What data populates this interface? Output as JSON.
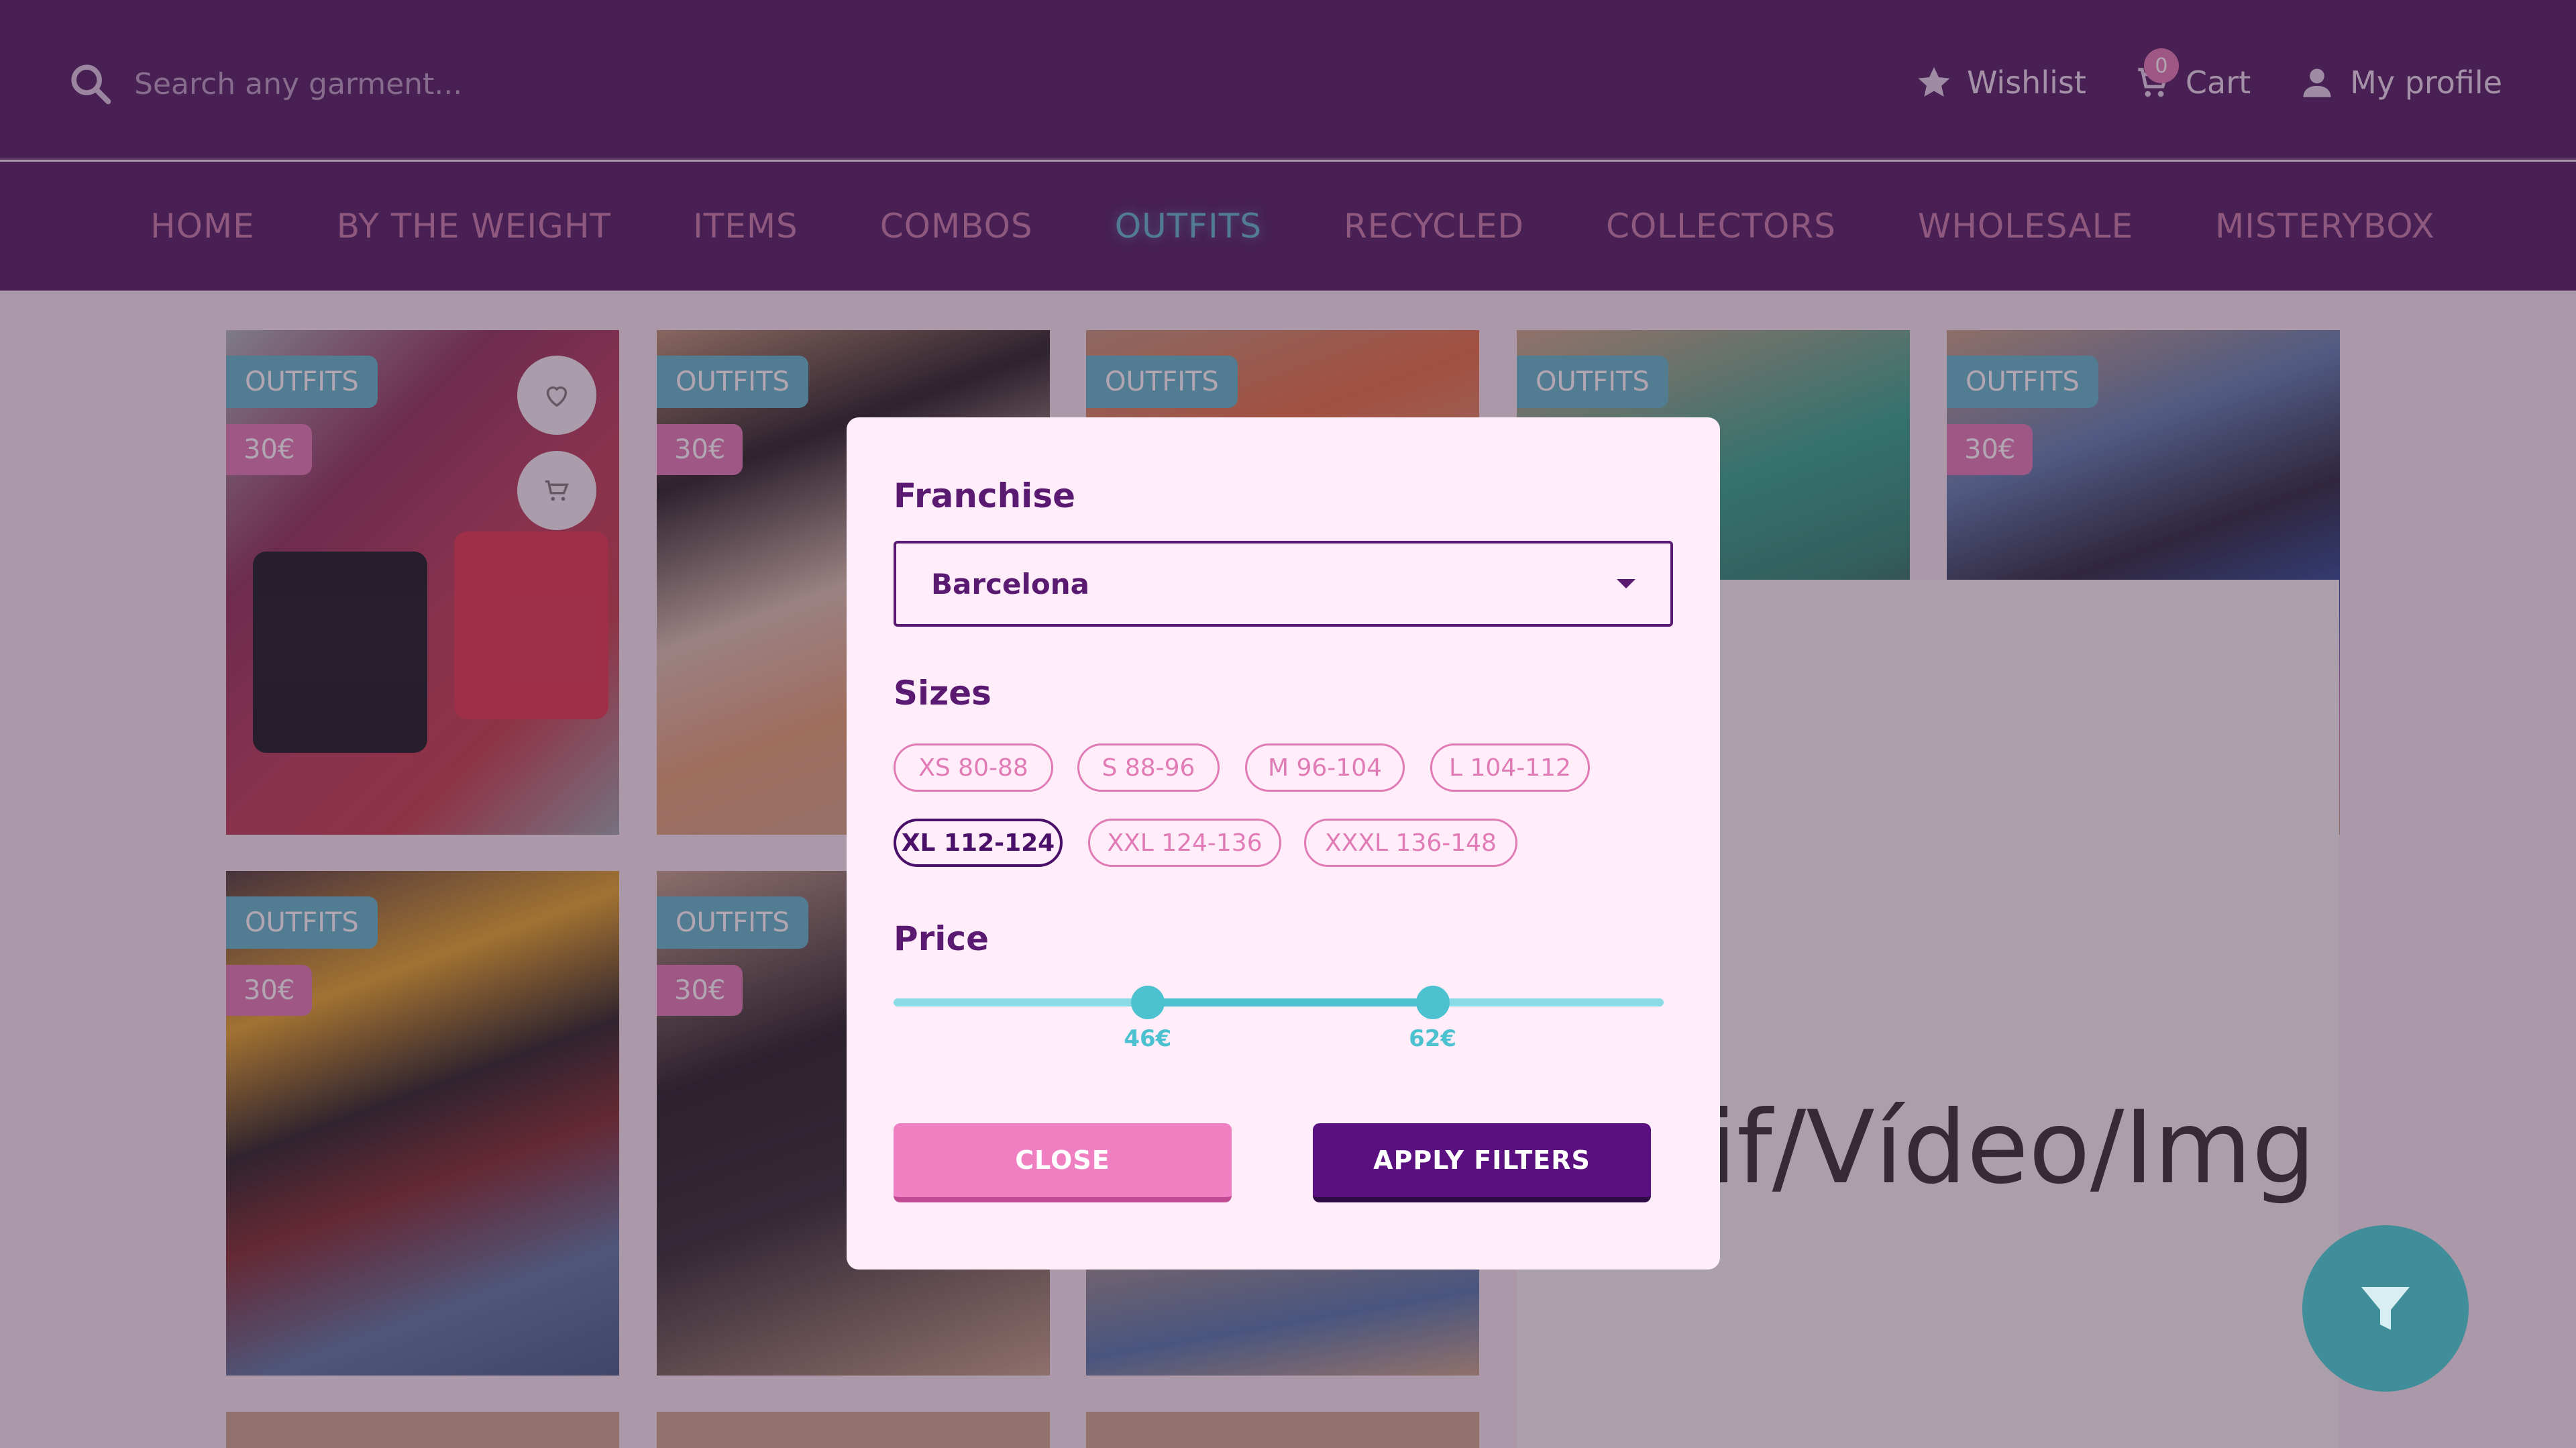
{
  "header": {
    "search_placeholder": "Search any garment...",
    "wishlist_label": "Wishlist",
    "cart_label": "Cart",
    "cart_count": "0",
    "profile_label": "My profile"
  },
  "nav": {
    "items": [
      "HOME",
      "BY THE WEIGHT",
      "ITEMS",
      "COMBOS",
      "OUTFITS",
      "RECYCLED",
      "COLLECTORS",
      "WHOLESALE",
      "MISTERYBOX"
    ],
    "active": "OUTFITS"
  },
  "products": [
    {
      "category": "OUTFITS",
      "price": "30€"
    },
    {
      "category": "OUTFITS",
      "price": "30€"
    },
    {
      "category": "OUTFITS",
      "price": "30€"
    },
    {
      "category": "OUTFITS",
      "price": "30€"
    },
    {
      "category": "OUTFITS",
      "price": "30€"
    },
    {
      "category": "OUTFITS",
      "price": "30€"
    },
    {
      "category": "OUTFITS",
      "price": "30€"
    },
    {
      "category": "OUTFITS",
      "price": "30€"
    }
  ],
  "media_placeholder": "Gif/Vídeo/Img",
  "filter_modal": {
    "franchise_title": "Franchise",
    "franchise_value": "Barcelona",
    "sizes_title": "Sizes",
    "sizes": [
      {
        "label": "XS 80-88",
        "selected": false
      },
      {
        "label": "S 88-96",
        "selected": false
      },
      {
        "label": "M 96-104",
        "selected": false
      },
      {
        "label": "L 104-112",
        "selected": false
      },
      {
        "label": "XL 112-124",
        "selected": true
      },
      {
        "label": "XXL 124-136",
        "selected": false
      },
      {
        "label": "XXXL 136-148",
        "selected": false
      }
    ],
    "price_title": "Price",
    "price_min_label": "46€",
    "price_max_label": "62€",
    "price_min_fraction": 0.33,
    "price_max_fraction": 0.7,
    "close_label": "CLOSE",
    "apply_label": "APPLY FILTERS"
  },
  "colors": {
    "brand_purple": "#4a1a5e",
    "accent_teal": "#5cb8c9",
    "accent_pink": "#e07bb6"
  }
}
